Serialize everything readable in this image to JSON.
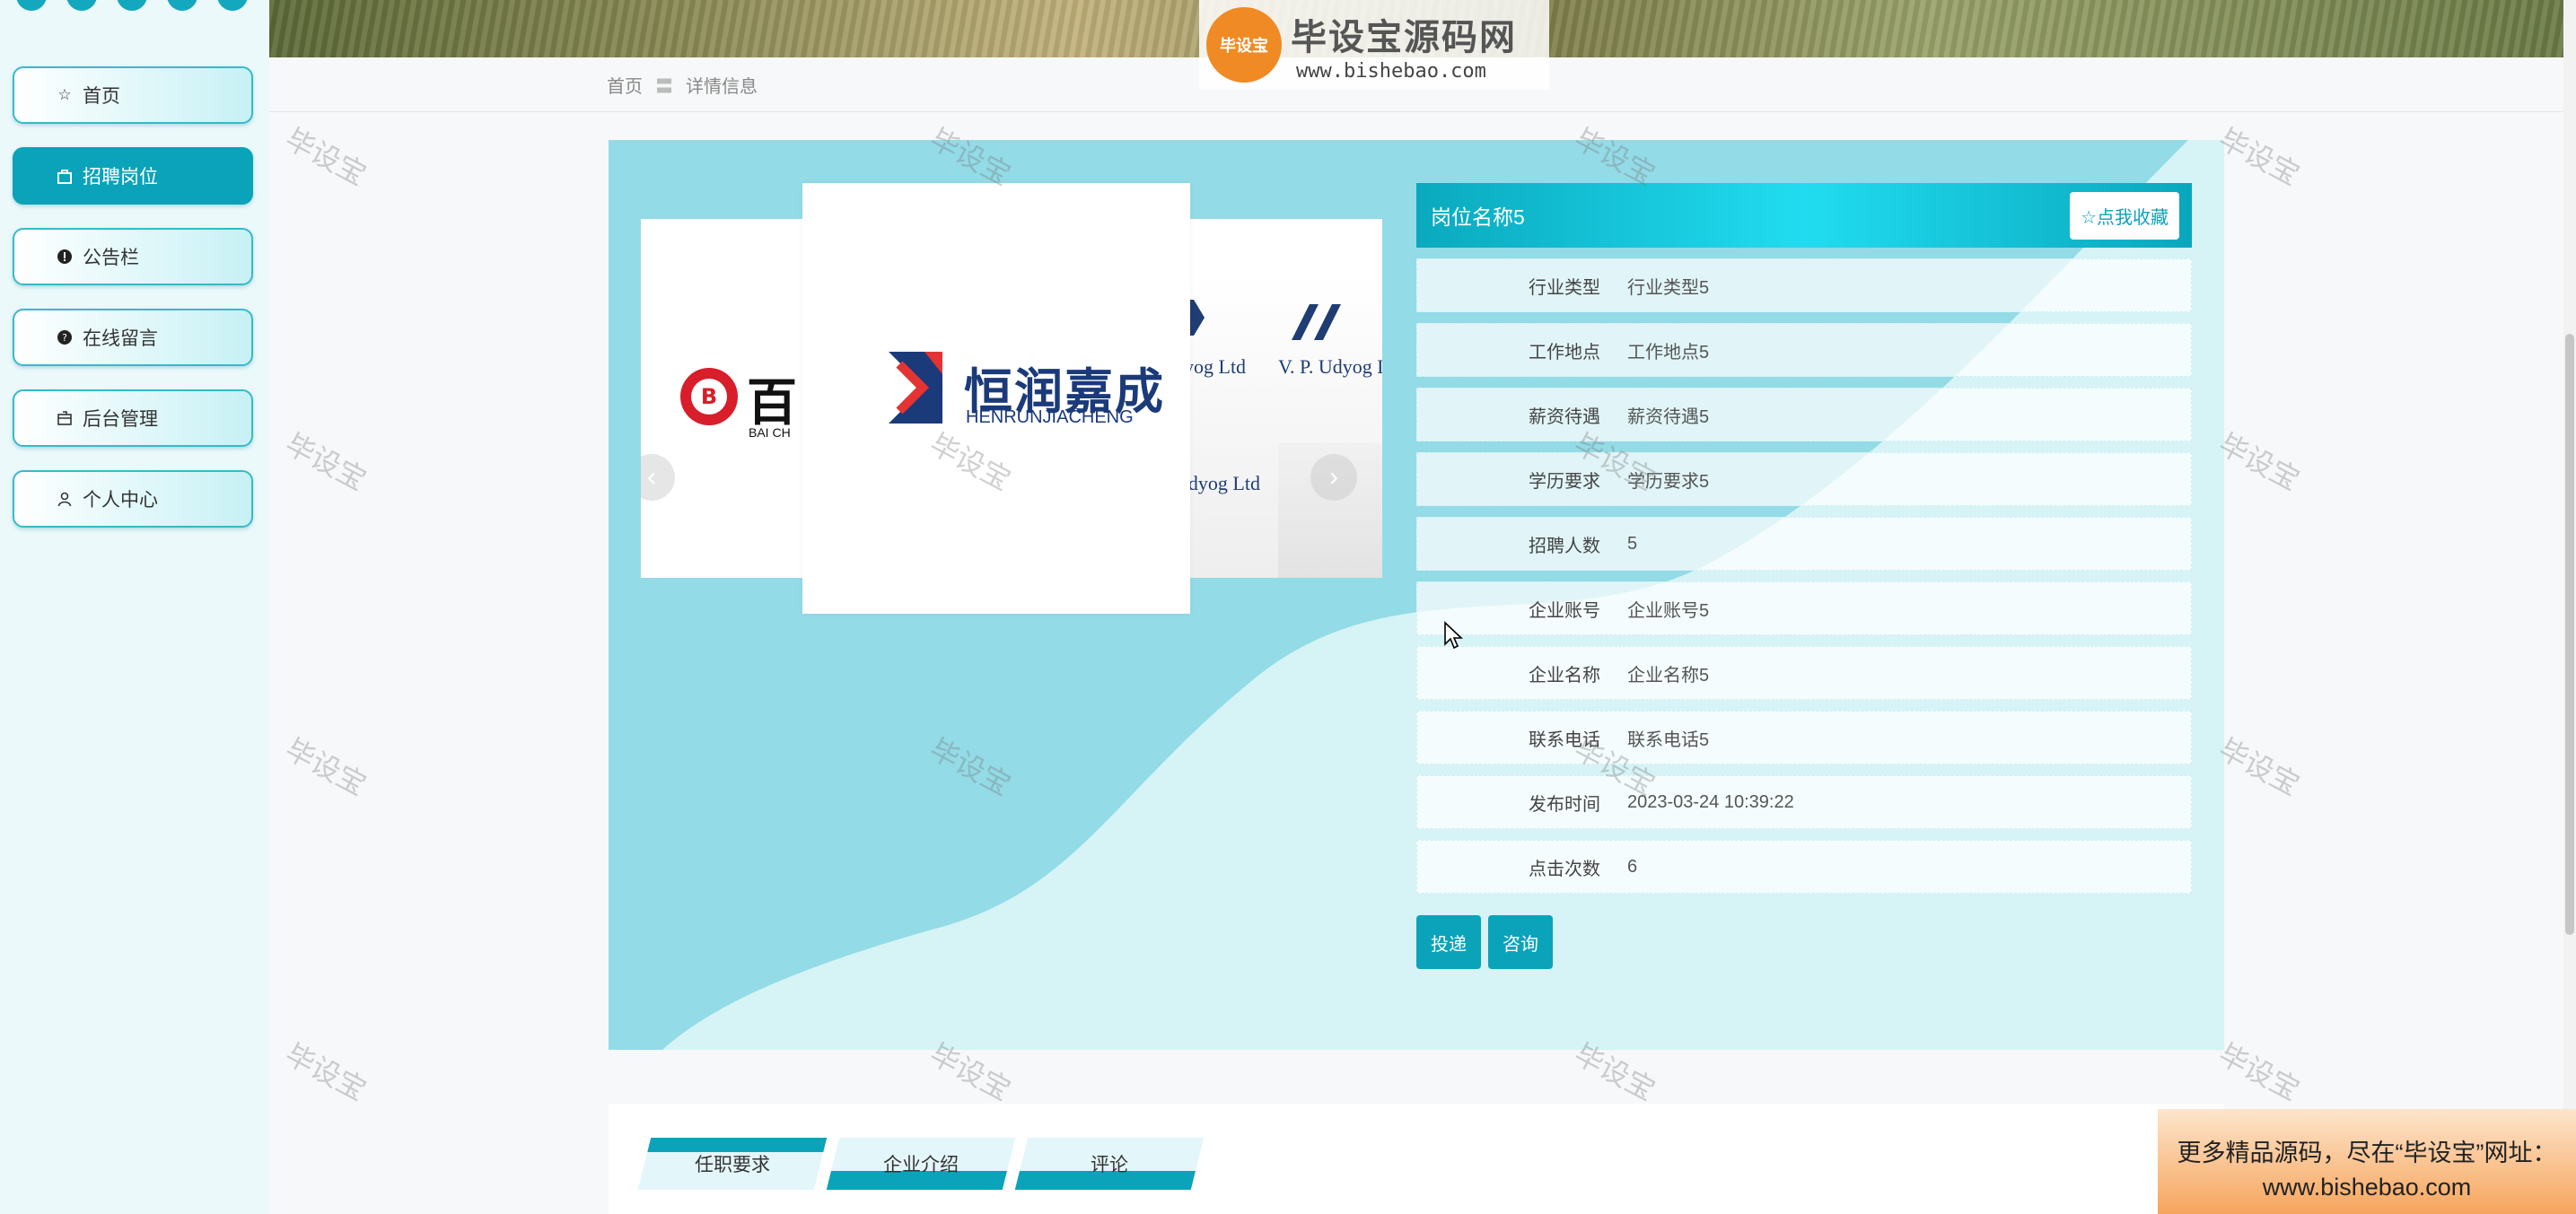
{
  "sidebar": {
    "items": [
      {
        "label": "首页",
        "icon": "star-icon",
        "active": false
      },
      {
        "label": "招聘岗位",
        "icon": "bag-icon",
        "active": true
      },
      {
        "label": "公告栏",
        "icon": "alert-circle-icon",
        "active": false
      },
      {
        "label": "在线留言",
        "icon": "help-circle-icon",
        "active": false
      },
      {
        "label": "后台管理",
        "icon": "box-icon",
        "active": false
      },
      {
        "label": "个人中心",
        "icon": "user-icon",
        "active": false
      }
    ]
  },
  "header": {
    "watermark_logo_badge": "毕设宝",
    "watermark_logo_title": "毕设宝源码网",
    "watermark_logo_url": "www.bishebao.com"
  },
  "breadcrumb": {
    "home": "首页",
    "separator": "〓",
    "current": "详情信息"
  },
  "carousel": {
    "slide_left_text": "百",
    "slide_left_sub": "BAI CH",
    "front_logo_cn": "恒润嘉成",
    "front_logo_en": "HENRUNJIACHENG",
    "right_logo_top": "V. P. Udyog Lt",
    "right_logo_mid": "dyog Ltd",
    "right_logo_bottom": "Udyog Ltd",
    "prev_label": "‹",
    "next_label": "›"
  },
  "job": {
    "title": "岗位名称5",
    "favorite_label": "☆点我收藏",
    "fields": [
      {
        "label": "行业类型",
        "value": "行业类型5"
      },
      {
        "label": "工作地点",
        "value": "工作地点5"
      },
      {
        "label": "薪资待遇",
        "value": "薪资待遇5"
      },
      {
        "label": "学历要求",
        "value": "学历要求5"
      },
      {
        "label": "招聘人数",
        "value": "5"
      },
      {
        "label": "企业账号",
        "value": "企业账号5"
      },
      {
        "label": "企业名称",
        "value": "企业名称5"
      },
      {
        "label": "联系电话",
        "value": "联系电话5"
      },
      {
        "label": "发布时间",
        "value": "2023-03-24 10:39:22"
      },
      {
        "label": "点击次数",
        "value": "6"
      }
    ],
    "apply_label": "投递",
    "consult_label": "咨询"
  },
  "tabs": [
    {
      "label": "任职要求"
    },
    {
      "label": "企业介绍"
    },
    {
      "label": "评论"
    }
  ],
  "promo": {
    "line1": "更多精品源码，尽在“毕设宝”网址：",
    "line2": "www.bishebao.com"
  },
  "watermark_text": "毕设宝",
  "colors": {
    "accent": "#0aa3ba",
    "panel": "#93dbe6",
    "panel_light": "#d6f3f6"
  }
}
